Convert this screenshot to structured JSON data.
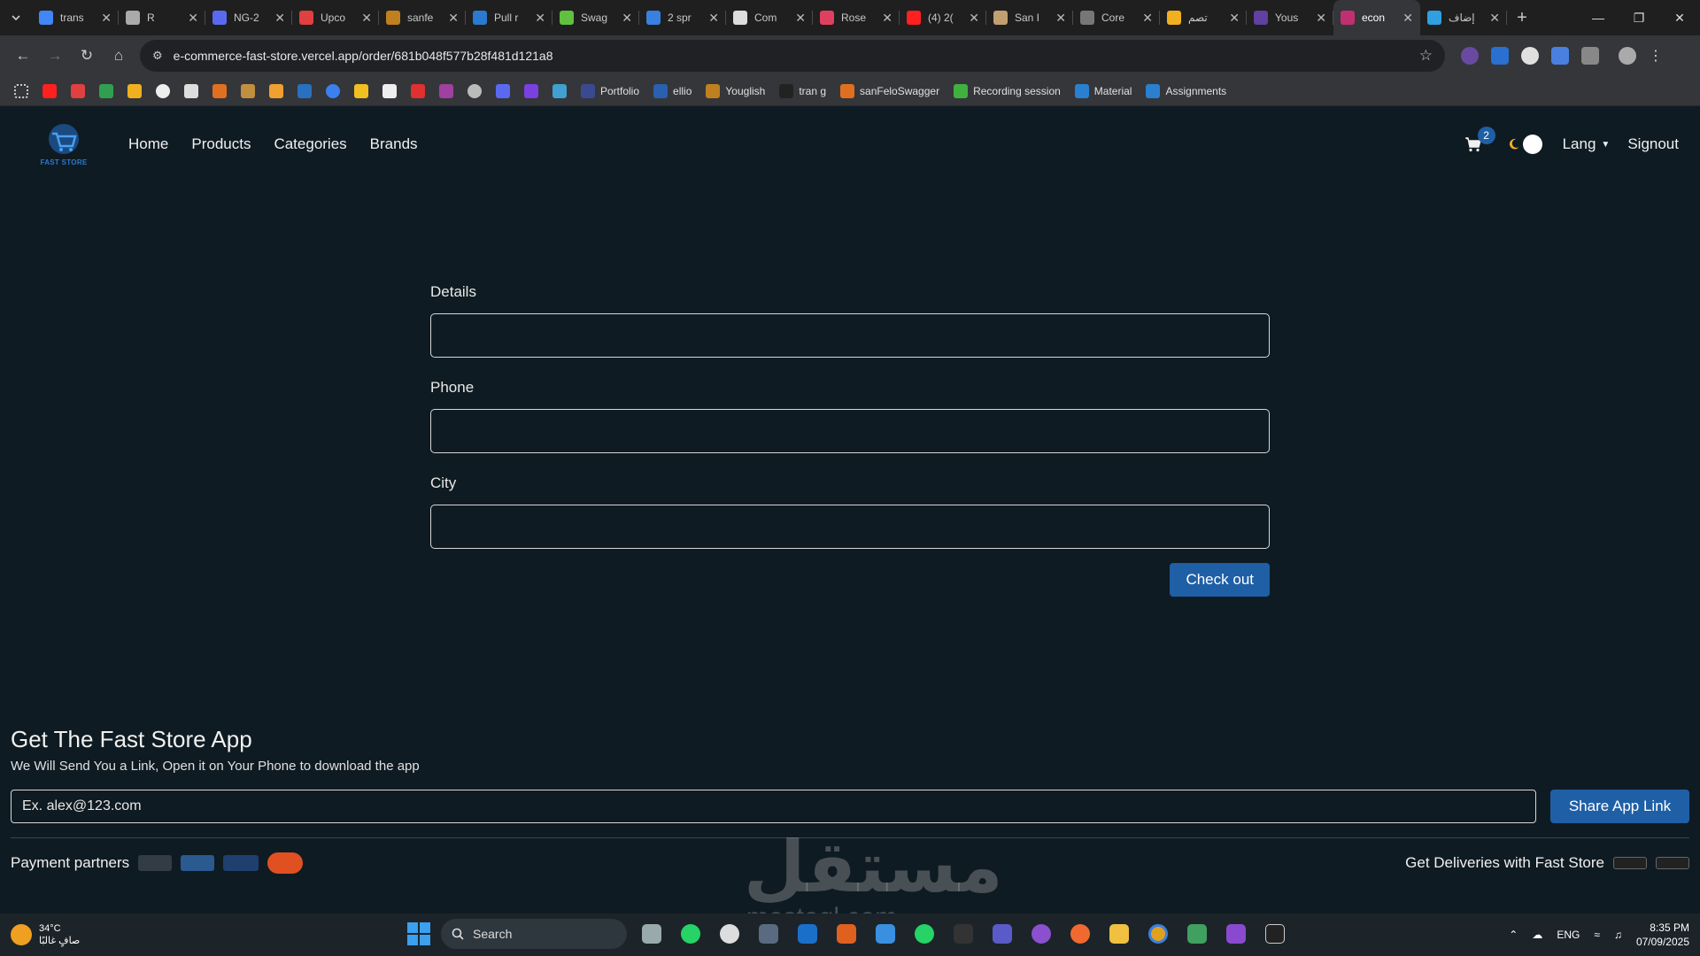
{
  "browser": {
    "tabs": [
      {
        "title": "trans",
        "color": "#4285f4"
      },
      {
        "title": "R",
        "color": "#aaaaaa"
      },
      {
        "title": "NG-2",
        "color": "#5a6af0"
      },
      {
        "title": "Upco",
        "color": "#e04040"
      },
      {
        "title": "sanfe",
        "color": "#c08020"
      },
      {
        "title": "Pull r",
        "color": "#2a7ad0"
      },
      {
        "title": "Swag",
        "color": "#60c040"
      },
      {
        "title": "2 spr",
        "color": "#3a80e0"
      },
      {
        "title": "Com",
        "color": "#dddddd"
      },
      {
        "title": "Rose",
        "color": "#e04060"
      },
      {
        "title": "(4) 2(",
        "color": "#ff2020"
      },
      {
        "title": "San I",
        "color": "#c0a070"
      },
      {
        "title": "Core",
        "color": "#777777"
      },
      {
        "title": "تصم",
        "color": "#f0b020"
      },
      {
        "title": "Yous",
        "color": "#6040a0"
      },
      {
        "title": "econ",
        "color": "#c03070"
      },
      {
        "title": "إضاف",
        "color": "#30a0e0"
      }
    ],
    "active_tab_index": 15,
    "url": "e-commerce-fast-store.vercel.app/order/681b048f577b28f481d121a8",
    "bookmarks": [
      {
        "label": "Portfolio"
      },
      {
        "label": "ellio"
      },
      {
        "label": "Youglish"
      },
      {
        "label": "tran g"
      },
      {
        "label": "sanFeloSwagger"
      },
      {
        "label": "Recording session"
      },
      {
        "label": "Material"
      },
      {
        "label": "Assignments"
      }
    ]
  },
  "nav": {
    "logo_text": "FAST STORE",
    "links": [
      "Home",
      "Products",
      "Categories",
      "Brands"
    ],
    "cart_count": "2",
    "lang_label": "Lang",
    "signout_label": "Signout"
  },
  "form": {
    "details_label": "Details",
    "phone_label": "Phone",
    "city_label": "City",
    "details_value": "",
    "phone_value": "",
    "city_value": "",
    "checkout_label": "Check out"
  },
  "app_section": {
    "title": "Get The Fast Store App",
    "subtitle": "We Will Send You a Link, Open it on Your Phone to download the app",
    "email_placeholder": "Ex. alex@123.com",
    "share_label": "Share App Link",
    "payment_label": "Payment partners",
    "deliveries_label": "Get Deliveries with Fast Store"
  },
  "watermark": {
    "text": "مستقل",
    "sub": "mostaql.com"
  },
  "taskbar": {
    "temperature": "34°C",
    "weather_text": "صافٍ غالبًا",
    "search_label": "Search",
    "lang": "ENG",
    "time": "8:35 PM",
    "date": "07/09/2025"
  },
  "colors": {
    "page_bg": "#0f1b22",
    "primary": "#1f5fa6"
  }
}
